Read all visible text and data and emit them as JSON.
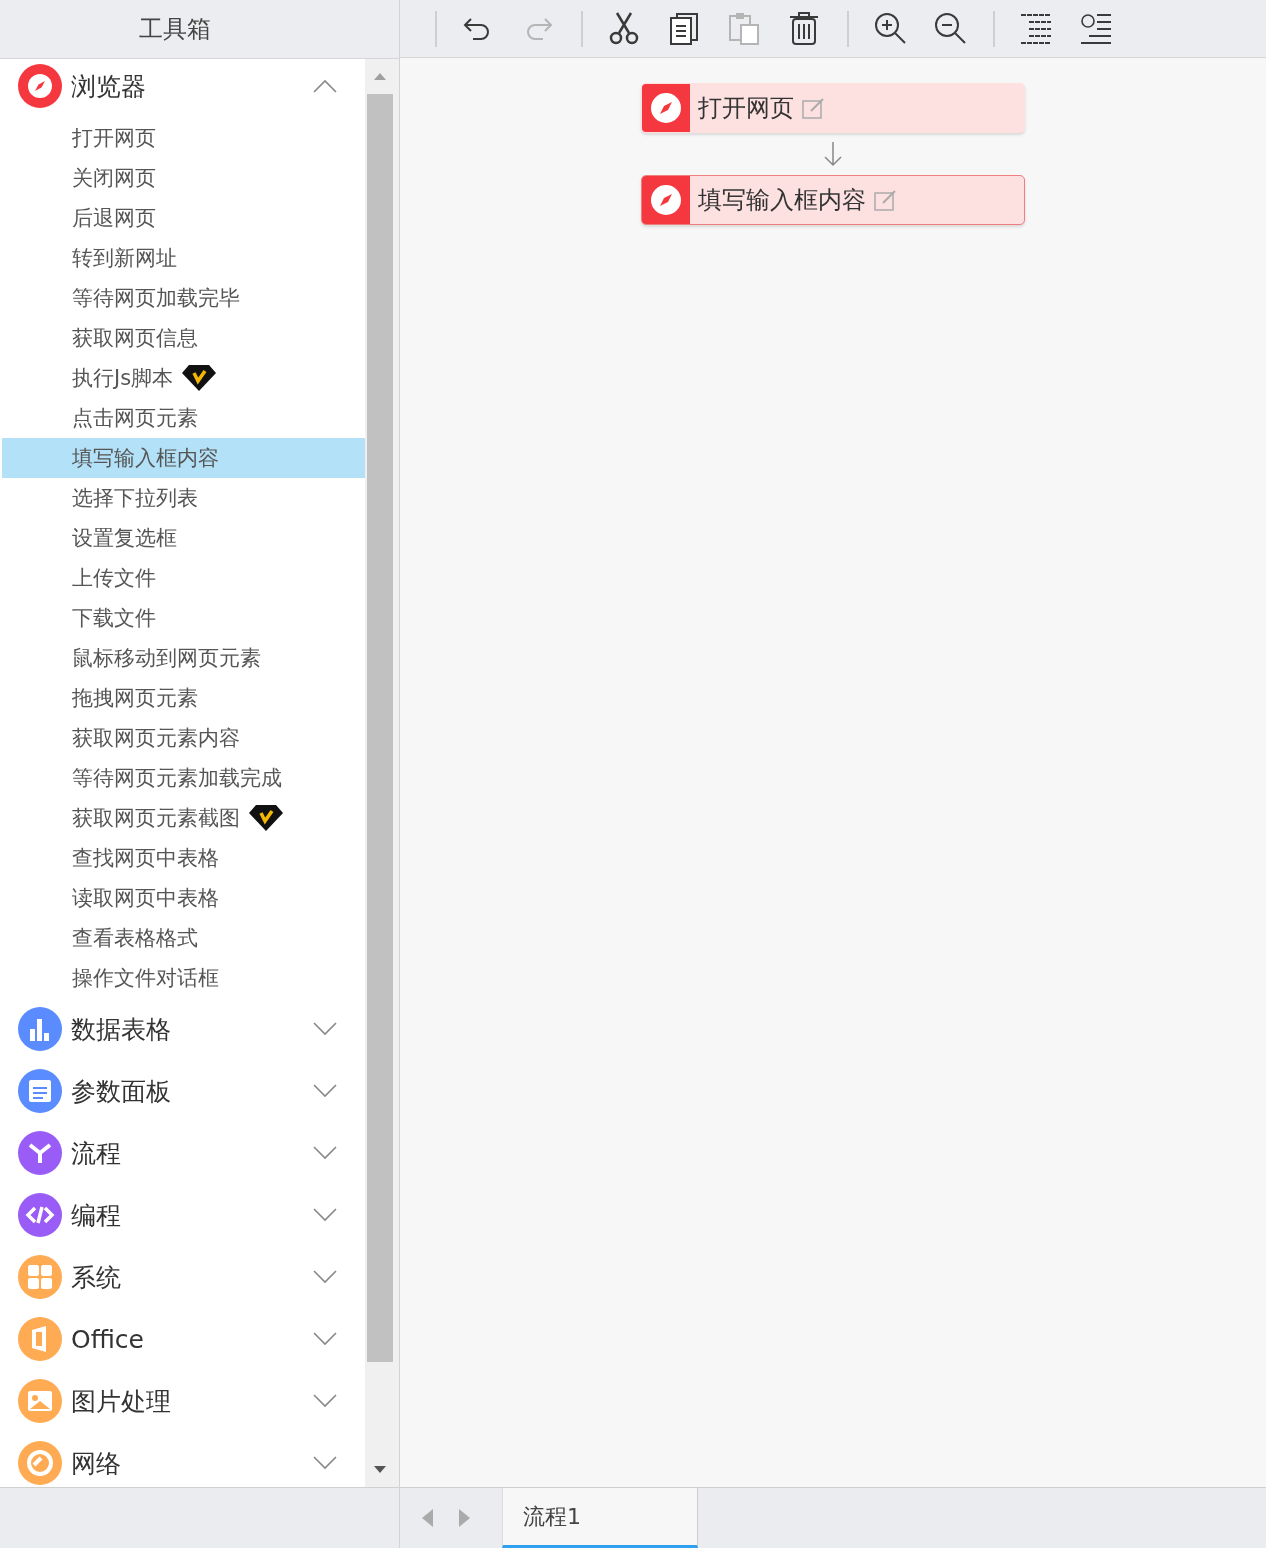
{
  "toolbox": {
    "title": "工具箱",
    "categories": [
      {
        "label": "浏览器",
        "expanded": true,
        "color": "#f5383f",
        "children": [
          {
            "label": "打开网页",
            "selected": false,
            "premium": false
          },
          {
            "label": "关闭网页",
            "selected": false,
            "premium": false
          },
          {
            "label": "后退网页",
            "selected": false,
            "premium": false
          },
          {
            "label": "转到新网址",
            "selected": false,
            "premium": false
          },
          {
            "label": "等待网页加载完毕",
            "selected": false,
            "premium": false
          },
          {
            "label": "获取网页信息",
            "selected": false,
            "premium": false
          },
          {
            "label": "执行Js脚本",
            "selected": false,
            "premium": true
          },
          {
            "label": "点击网页元素",
            "selected": false,
            "premium": false
          },
          {
            "label": "填写输入框内容",
            "selected": true,
            "premium": false
          },
          {
            "label": "选择下拉列表",
            "selected": false,
            "premium": false
          },
          {
            "label": "设置复选框",
            "selected": false,
            "premium": false
          },
          {
            "label": "上传文件",
            "selected": false,
            "premium": false
          },
          {
            "label": "下载文件",
            "selected": false,
            "premium": false
          },
          {
            "label": "鼠标移动到网页元素",
            "selected": false,
            "premium": false
          },
          {
            "label": "拖拽网页元素",
            "selected": false,
            "premium": false
          },
          {
            "label": "获取网页元素内容",
            "selected": false,
            "premium": false
          },
          {
            "label": "等待网页元素加载完成",
            "selected": false,
            "premium": false
          },
          {
            "label": "获取网页元素截图",
            "selected": false,
            "premium": true
          },
          {
            "label": "查找网页中表格",
            "selected": false,
            "premium": false
          },
          {
            "label": "读取网页中表格",
            "selected": false,
            "premium": false
          },
          {
            "label": "查看表格格式",
            "selected": false,
            "premium": false
          },
          {
            "label": "操作文件对话框",
            "selected": false,
            "premium": false
          }
        ]
      },
      {
        "label": "数据表格",
        "expanded": false,
        "color": "#5b8cff"
      },
      {
        "label": "参数面板",
        "expanded": false,
        "color": "#5b8cff"
      },
      {
        "label": "流程",
        "expanded": false,
        "color": "#9a5cf6"
      },
      {
        "label": "编程",
        "expanded": false,
        "color": "#9a5cf6"
      },
      {
        "label": "系统",
        "expanded": false,
        "color": "#ffab54"
      },
      {
        "label": "Office",
        "expanded": false,
        "color": "#ffab54"
      },
      {
        "label": "图片处理",
        "expanded": false,
        "color": "#ffab54"
      },
      {
        "label": "网络",
        "expanded": false,
        "color": "#ffab54"
      }
    ]
  },
  "toolbar": {
    "groups": [
      [
        {
          "disabled": false
        },
        {
          "disabled": true
        }
      ],
      [
        {
          "disabled": false
        },
        {
          "disabled": false
        },
        {
          "disabled": true
        },
        {
          "disabled": false
        }
      ],
      [
        {
          "disabled": false
        },
        {
          "disabled": false
        }
      ],
      [
        {
          "disabled": false
        },
        {
          "disabled": false
        }
      ]
    ]
  },
  "flow": {
    "nodes": [
      {
        "label": "打开网页",
        "selected": false
      },
      {
        "label": "填写输入框内容",
        "selected": true
      }
    ]
  },
  "tabs": [
    {
      "label": "流程1",
      "selected": true
    }
  ]
}
